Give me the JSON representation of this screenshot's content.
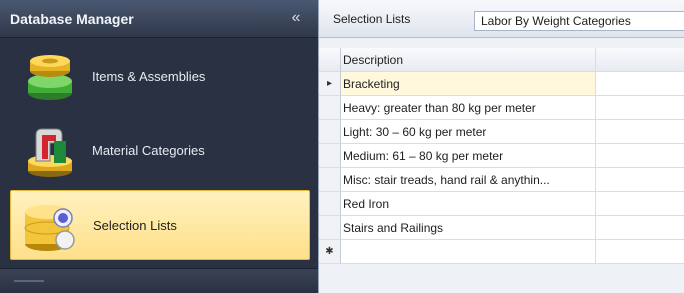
{
  "nav": {
    "title": "Database Manager",
    "collapse_glyph": "«",
    "items": [
      {
        "label": "Items & Assemblies",
        "icon": "items-assemblies-icon",
        "active": false
      },
      {
        "label": "Material Categories",
        "icon": "material-categories-icon",
        "active": false
      },
      {
        "label": "Selection Lists",
        "icon": "selection-lists-icon",
        "active": true
      }
    ]
  },
  "toolbar": {
    "label": "Selection Lists",
    "combo_value": "Labor By Weight Categories"
  },
  "grid": {
    "column_header": "Description",
    "current_row_glyph": "▸",
    "new_row_glyph": "✱",
    "rows": [
      "Bracketing",
      "Heavy: greater than 80 kg per meter",
      "Light: 30 – 60 kg per meter",
      "Medium: 61 – 80 kg per meter",
      "Misc: stair treads, hand rail & anythin...",
      "Red Iron",
      "Stairs and Railings"
    ]
  },
  "colors": {
    "nav_bg": "#2a3142",
    "active_item": "#ffe08a",
    "selected_row": "#fff8dc"
  }
}
